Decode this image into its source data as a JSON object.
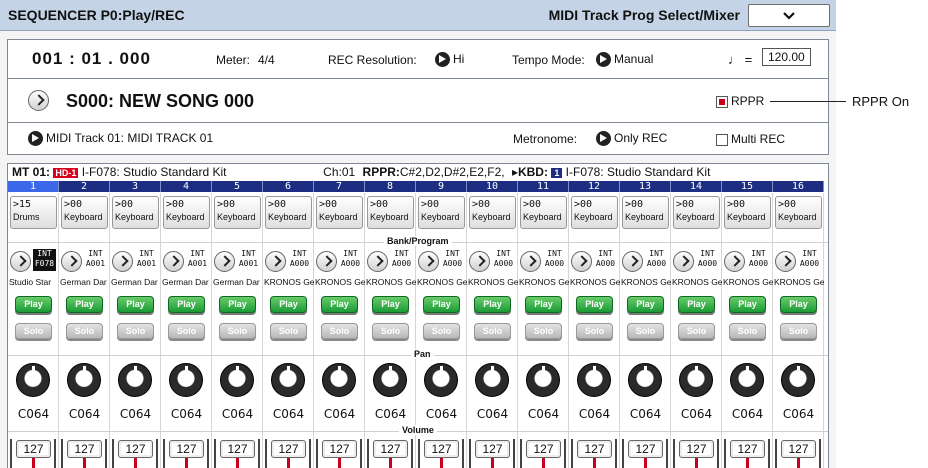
{
  "title": {
    "left": "SEQUENCER P0:Play/REC",
    "right": "MIDI Track Prog Select/Mixer"
  },
  "header": {
    "location": "001 : 01 . 000",
    "meter_label": "Meter:",
    "meter_value": "4/4",
    "rec_res_label": "REC Resolution:",
    "rec_res_value": "Hi",
    "tempo_mode_label": "Tempo Mode:",
    "tempo_mode_value": "Manual",
    "tempo_symbol": "♩ =",
    "tempo_value": "120.00"
  },
  "song": {
    "name": "S000: NEW SONG 000",
    "rppr_label": "RPPR",
    "rppr_checked": true
  },
  "track_row": {
    "track": "MIDI Track 01: MIDI TRACK 01",
    "metronome_label": "Metronome:",
    "metronome_value": "Only REC",
    "multi_rec_label": "Multi REC"
  },
  "callout": "RPPR On",
  "track_info": {
    "mt": "MT 01:",
    "hd": "HD-1",
    "program": "I-F078: Studio Standard Kit",
    "ch": "Ch:01",
    "rppr_label": "RPPR:",
    "rppr_notes": "C#2,D2,D#2,E2,F2,",
    "kbd_label": "KBD:",
    "kbd_badge": "1",
    "kbd_program": "I-F078: Studio Standard Kit"
  },
  "labels": {
    "bank_program": "Bank/Program",
    "pan": "Pan",
    "volume": "Volume"
  },
  "colors": {
    "header_blue": "#1d2e82",
    "play_green": "#1a9b35",
    "rppr_red": "#c8001e"
  },
  "tracks": [
    {
      "num": "1",
      "cat_num": "15",
      "cat": "Drums",
      "bank_top": "INT",
      "bank_bottom": "F078",
      "prog": "Studio Star",
      "play": "Play",
      "solo": "Solo",
      "pan": "C064",
      "vol": "127"
    },
    {
      "num": "2",
      "cat_num": "00",
      "cat": "Keyboard",
      "bank_top": "INT",
      "bank_bottom": "A001",
      "prog": "German Dar",
      "play": "Play",
      "solo": "Solo",
      "pan": "C064",
      "vol": "127"
    },
    {
      "num": "3",
      "cat_num": "00",
      "cat": "Keyboard",
      "bank_top": "INT",
      "bank_bottom": "A001",
      "prog": "German Dar",
      "play": "Play",
      "solo": "Solo",
      "pan": "C064",
      "vol": "127"
    },
    {
      "num": "4",
      "cat_num": "00",
      "cat": "Keyboard",
      "bank_top": "INT",
      "bank_bottom": "A001",
      "prog": "German Dar",
      "play": "Play",
      "solo": "Solo",
      "pan": "C064",
      "vol": "127"
    },
    {
      "num": "5",
      "cat_num": "00",
      "cat": "Keyboard",
      "bank_top": "INT",
      "bank_bottom": "A001",
      "prog": "German Dar",
      "play": "Play",
      "solo": "Solo",
      "pan": "C064",
      "vol": "127"
    },
    {
      "num": "6",
      "cat_num": "00",
      "cat": "Keyboard",
      "bank_top": "INT",
      "bank_bottom": "A000",
      "prog": "KRONOS Ge",
      "play": "Play",
      "solo": "Solo",
      "pan": "C064",
      "vol": "127"
    },
    {
      "num": "7",
      "cat_num": "00",
      "cat": "Keyboard",
      "bank_top": "INT",
      "bank_bottom": "A000",
      "prog": "KRONOS Ge",
      "play": "Play",
      "solo": "Solo",
      "pan": "C064",
      "vol": "127"
    },
    {
      "num": "8",
      "cat_num": "00",
      "cat": "Keyboard",
      "bank_top": "INT",
      "bank_bottom": "A000",
      "prog": "KRONOS Ge",
      "play": "Play",
      "solo": "Solo",
      "pan": "C064",
      "vol": "127"
    },
    {
      "num": "9",
      "cat_num": "00",
      "cat": "Keyboard",
      "bank_top": "INT",
      "bank_bottom": "A000",
      "prog": "KRONOS Ge",
      "play": "Play",
      "solo": "Solo",
      "pan": "C064",
      "vol": "127"
    },
    {
      "num": "10",
      "cat_num": "00",
      "cat": "Keyboard",
      "bank_top": "INT",
      "bank_bottom": "A000",
      "prog": "KRONOS Ge",
      "play": "Play",
      "solo": "Solo",
      "pan": "C064",
      "vol": "127"
    },
    {
      "num": "11",
      "cat_num": "00",
      "cat": "Keyboard",
      "bank_top": "INT",
      "bank_bottom": "A000",
      "prog": "KRONOS Ge",
      "play": "Play",
      "solo": "Solo",
      "pan": "C064",
      "vol": "127"
    },
    {
      "num": "12",
      "cat_num": "00",
      "cat": "Keyboard",
      "bank_top": "INT",
      "bank_bottom": "A000",
      "prog": "KRONOS Ge",
      "play": "Play",
      "solo": "Solo",
      "pan": "C064",
      "vol": "127"
    },
    {
      "num": "13",
      "cat_num": "00",
      "cat": "Keyboard",
      "bank_top": "INT",
      "bank_bottom": "A000",
      "prog": "KRONOS Ge",
      "play": "Play",
      "solo": "Solo",
      "pan": "C064",
      "vol": "127"
    },
    {
      "num": "14",
      "cat_num": "00",
      "cat": "Keyboard",
      "bank_top": "INT",
      "bank_bottom": "A000",
      "prog": "KRONOS Ge",
      "play": "Play",
      "solo": "Solo",
      "pan": "C064",
      "vol": "127"
    },
    {
      "num": "15",
      "cat_num": "00",
      "cat": "Keyboard",
      "bank_top": "INT",
      "bank_bottom": "A000",
      "prog": "KRONOS Ge",
      "play": "Play",
      "solo": "Solo",
      "pan": "C064",
      "vol": "127"
    },
    {
      "num": "16",
      "cat_num": "00",
      "cat": "Keyboard",
      "bank_top": "INT",
      "bank_bottom": "A000",
      "prog": "KRONOS Ge",
      "play": "Play",
      "solo": "Solo",
      "pan": "C064",
      "vol": "127"
    }
  ]
}
